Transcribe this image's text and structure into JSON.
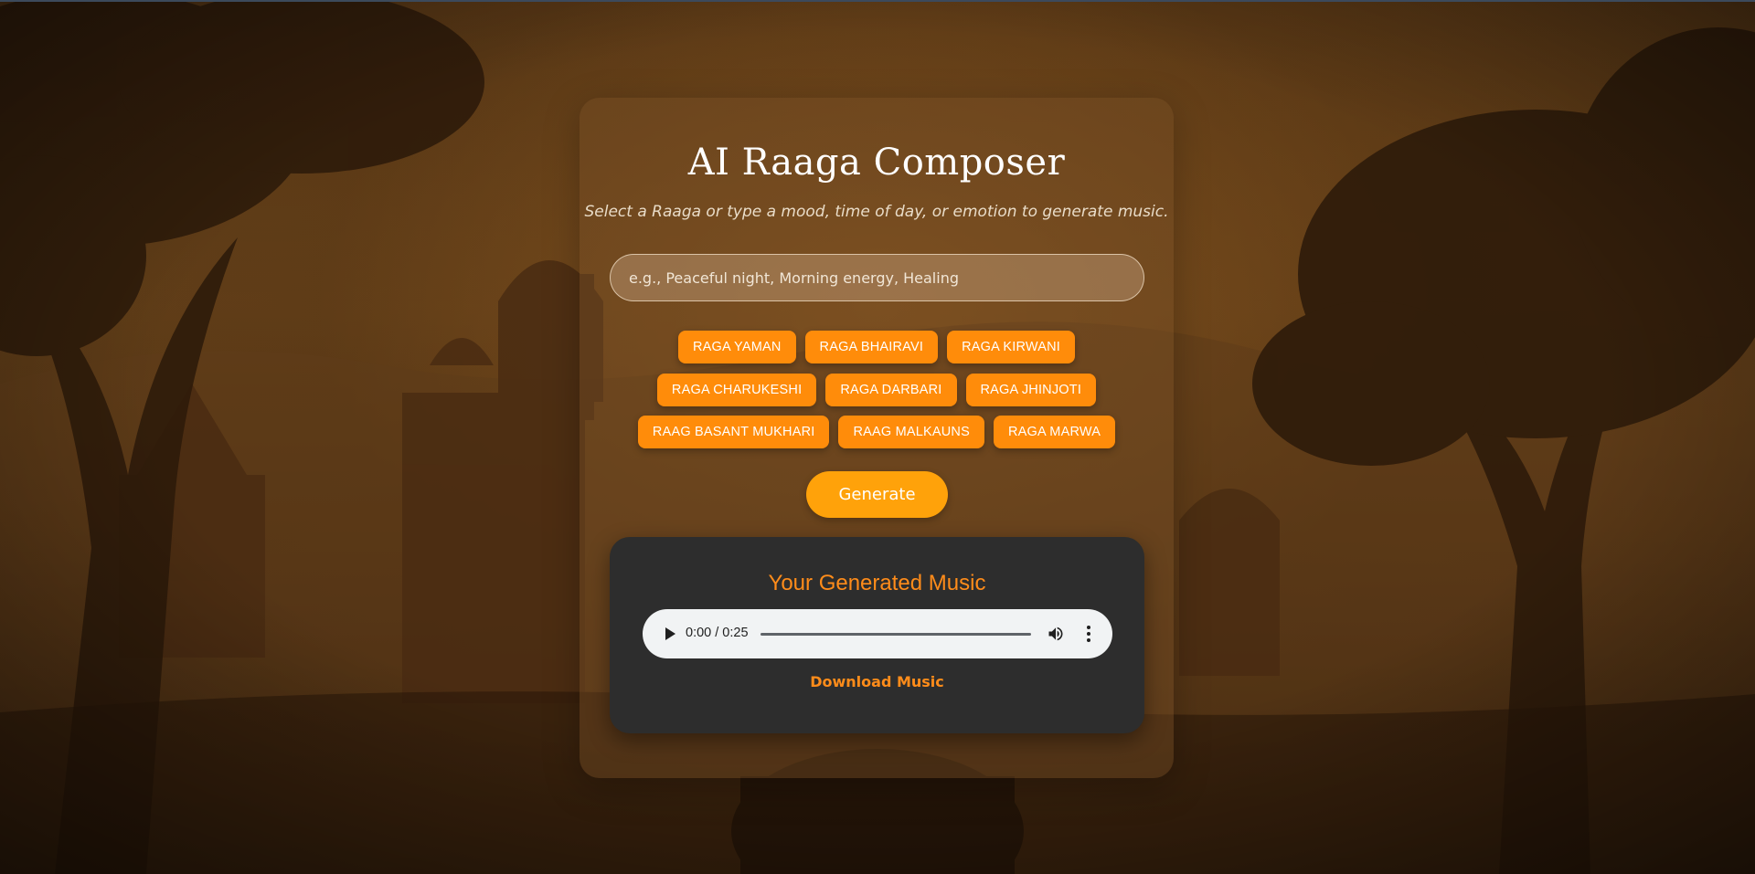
{
  "header": {
    "title": "AI Raaga Composer",
    "subtitle": "Select a Raaga or type a mood, time of day, or emotion to generate music."
  },
  "search": {
    "placeholder": "e.g., Peaceful night, Morning energy, Healing",
    "value": ""
  },
  "raagas": {
    "row1": [
      "RAGA YAMAN",
      "RAGA BHAIRAVI",
      "RAGA KIRWANI"
    ],
    "row2": [
      "RAGA CHARUKESHI",
      "RAGA DARBARI",
      "RAGA JHINJOTI"
    ],
    "row3": [
      "RAAG BASANT MUKHARI",
      "RAAG MALKAUNS",
      "RAGA MARWA"
    ]
  },
  "generate_label": "Generate",
  "result": {
    "title": "Your Generated Music",
    "player": {
      "time": "0:00 / 0:25",
      "progress": 0
    },
    "download_label": "Download Music"
  },
  "colors": {
    "accent": "#ff8c0a",
    "generate": "#ffa20a",
    "result_bg": "#2d2d2d",
    "result_title": "#ff8c1a"
  },
  "icons": {
    "play": "play-icon",
    "volume": "volume-icon",
    "more": "more-vertical-icon"
  }
}
